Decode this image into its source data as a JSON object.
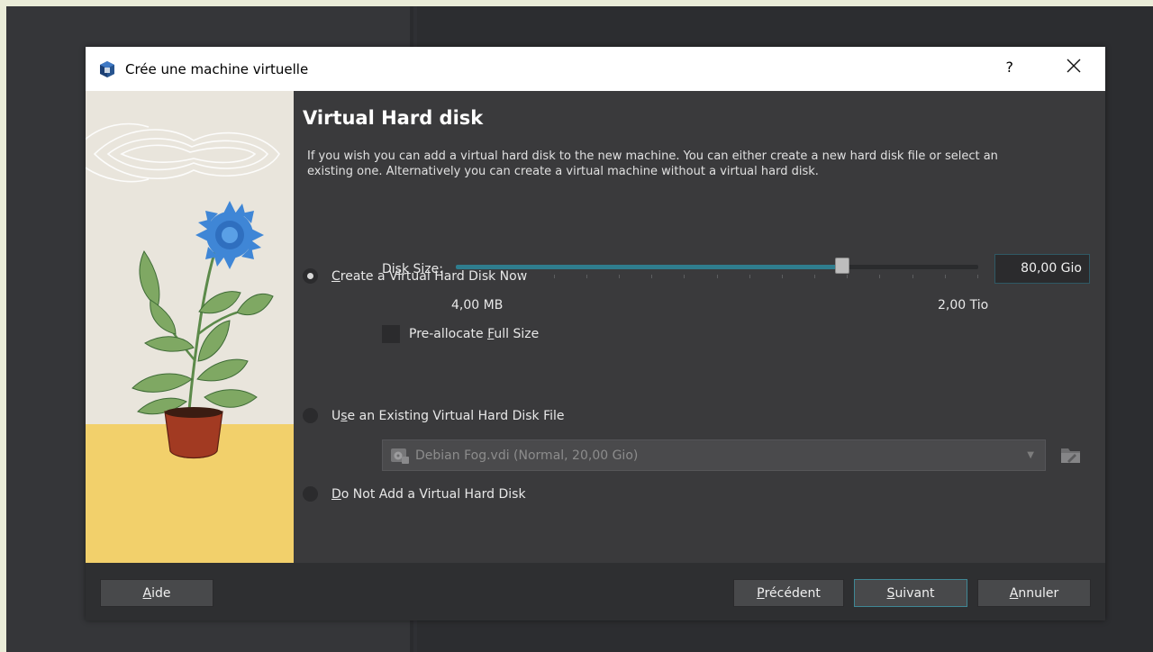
{
  "dialog": {
    "title": "Crée une machine virtuelle",
    "help_glyph": "?"
  },
  "page": {
    "heading": "Virtual Hard disk",
    "description": "If you wish you can add a virtual hard disk to the new machine. You can either create a new hard disk file or select an existing one. Alternatively you can create a virtual machine without a virtual hard disk."
  },
  "options": {
    "create_now": {
      "accel": "C",
      "label_rest": "reate a Virtual Hard Disk Now",
      "selected": true
    },
    "use_existing": {
      "pre": "U",
      "accel": "s",
      "label_rest": "e an Existing Virtual Hard Disk File",
      "selected": false
    },
    "do_not_add": {
      "accel": "D",
      "label_rest": "o Not Add a Virtual Hard Disk",
      "selected": false
    }
  },
  "disk": {
    "label_pre": "Di",
    "label_accel": "s",
    "label_post": "k Size:",
    "value": "80,00 Gio",
    "min_label": "4,00 MB",
    "max_label": "2,00 Tio",
    "slider_fraction": 0.74,
    "tick_count": 17
  },
  "preallocate": {
    "label_pre": "Pre-allocate ",
    "label_accel": "F",
    "label_post": "ull Size",
    "checked": false
  },
  "existing_file": {
    "selected": "Debian Fog.vdi (Normal, 20,00 Gio)"
  },
  "buttons": {
    "help": {
      "accel": "A",
      "rest": "ide"
    },
    "back": {
      "accel": "P",
      "rest": "récédent"
    },
    "next": {
      "accel": "S",
      "rest": "uivant"
    },
    "cancel": {
      "accel": "A",
      "rest": "nnuler"
    }
  },
  "colors": {
    "accent": "#2f7d8e",
    "dialog_bg": "#3a3a3c",
    "footer_bg": "#2e2f31",
    "illustration_sky": "#e9e5dc",
    "illustration_table": "#f2d06b"
  },
  "icons": {
    "app": "virtualbox-cube-icon",
    "close": "close-icon",
    "vdi": "disk-image-icon",
    "browse": "folder-browse-icon",
    "dropdown": "chevron-down-icon"
  }
}
